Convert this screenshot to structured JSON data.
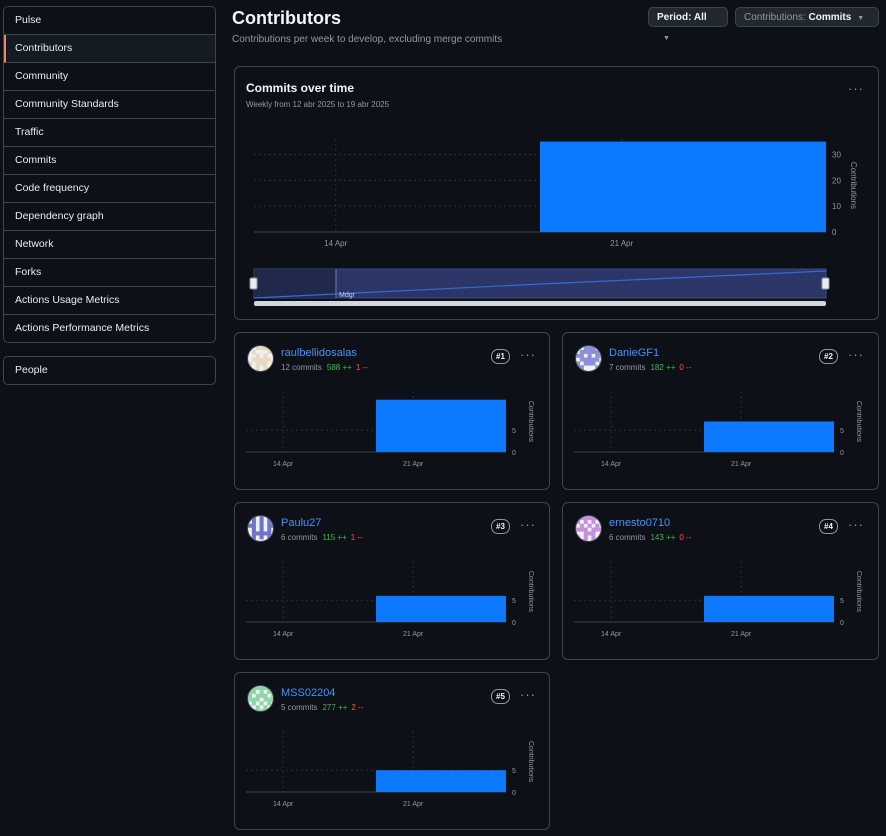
{
  "sidebar": {
    "items": [
      {
        "label": "Pulse"
      },
      {
        "label": "Contributors"
      },
      {
        "label": "Community"
      },
      {
        "label": "Community Standards"
      },
      {
        "label": "Traffic"
      },
      {
        "label": "Commits"
      },
      {
        "label": "Code frequency"
      },
      {
        "label": "Dependency graph"
      },
      {
        "label": "Network"
      },
      {
        "label": "Forks"
      },
      {
        "label": "Actions Usage Metrics"
      },
      {
        "label": "Actions Performance Metrics"
      }
    ],
    "people_label": "People"
  },
  "header": {
    "title": "Contributors",
    "subtitle": "Contributions per week to develop, excluding merge commits",
    "period_label": "Period: All",
    "contrib_label": "Contributions:",
    "contrib_value": "Commits"
  },
  "overview": {
    "title": "Commits over time",
    "range": "Weekly from 12 abr 2025 to 19 abr 2025",
    "more": "···",
    "brush_label": "Mdgr"
  },
  "contributors": [
    {
      "name": "raulbellidosalas",
      "commits": "12 commits",
      "additions": "588 ++",
      "deletions": "1 --",
      "rank": "#1",
      "avatar_color": "#e8d9c4",
      "more": "···"
    },
    {
      "name": "DanieGF1",
      "commits": "7 commits",
      "additions": "182 ++",
      "deletions": "0 --",
      "rank": "#2",
      "avatar_color": "#8b8fd6",
      "more": "···"
    },
    {
      "name": "Paulu27",
      "commits": "6 commits",
      "additions": "115 ++",
      "deletions": "1 --",
      "rank": "#3",
      "avatar_color": "#6d74c9",
      "more": "···"
    },
    {
      "name": "ernesto0710",
      "commits": "6 commits",
      "additions": "143 ++",
      "deletions": "0 --",
      "rank": "#4",
      "avatar_color": "#c78fe0",
      "more": "···"
    },
    {
      "name": "MSS02204",
      "commits": "5 commits",
      "additions": "277 ++",
      "deletions": "2 --",
      "rank": "#5",
      "avatar_color": "#8fd6a6",
      "more": "···"
    }
  ],
  "chart_data": [
    {
      "type": "bar",
      "title": "Commits over time",
      "ylabel": "Contributions",
      "x_ticks": [
        "14 Apr",
        "21 Apr"
      ],
      "y_ticks": [
        0,
        10,
        20,
        30
      ],
      "ylim": [
        0,
        36
      ],
      "bars": [
        {
          "start": "19 Apr",
          "end": "26 Apr",
          "value": 35
        }
      ],
      "color": "#0d79ff"
    },
    {
      "type": "bar",
      "title": "raulbellidosalas",
      "ylabel": "Contributions",
      "x_ticks": [
        "14 Apr",
        "21 Apr"
      ],
      "y_ticks": [
        0,
        5
      ],
      "ylim": [
        0,
        14
      ],
      "bars": [
        {
          "start": "19 Apr",
          "end": "26 Apr",
          "value": 12
        }
      ],
      "color": "#0d79ff"
    },
    {
      "type": "bar",
      "title": "DanieGF1",
      "ylabel": "Contributions",
      "x_ticks": [
        "14 Apr",
        "21 Apr"
      ],
      "y_ticks": [
        0,
        5
      ],
      "ylim": [
        0,
        14
      ],
      "bars": [
        {
          "start": "19 Apr",
          "end": "26 Apr",
          "value": 7
        }
      ],
      "color": "#0d79ff"
    },
    {
      "type": "bar",
      "title": "Paulu27",
      "ylabel": "Contributions",
      "x_ticks": [
        "14 Apr",
        "21 Apr"
      ],
      "y_ticks": [
        0,
        5
      ],
      "ylim": [
        0,
        14
      ],
      "bars": [
        {
          "start": "19 Apr",
          "end": "26 Apr",
          "value": 6
        }
      ],
      "color": "#0d79ff"
    },
    {
      "type": "bar",
      "title": "ernesto0710",
      "ylabel": "Contributions",
      "x_ticks": [
        "14 Apr",
        "21 Apr"
      ],
      "y_ticks": [
        0,
        5
      ],
      "ylim": [
        0,
        14
      ],
      "bars": [
        {
          "start": "19 Apr",
          "end": "26 Apr",
          "value": 6
        }
      ],
      "color": "#0d79ff"
    },
    {
      "type": "bar",
      "title": "MSS02204",
      "ylabel": "Contributions",
      "x_ticks": [
        "14 Apr",
        "21 Apr"
      ],
      "y_ticks": [
        0,
        5
      ],
      "ylim": [
        0,
        14
      ],
      "bars": [
        {
          "start": "19 Apr",
          "end": "26 Apr",
          "value": 5
        }
      ],
      "color": "#0d79ff"
    }
  ]
}
